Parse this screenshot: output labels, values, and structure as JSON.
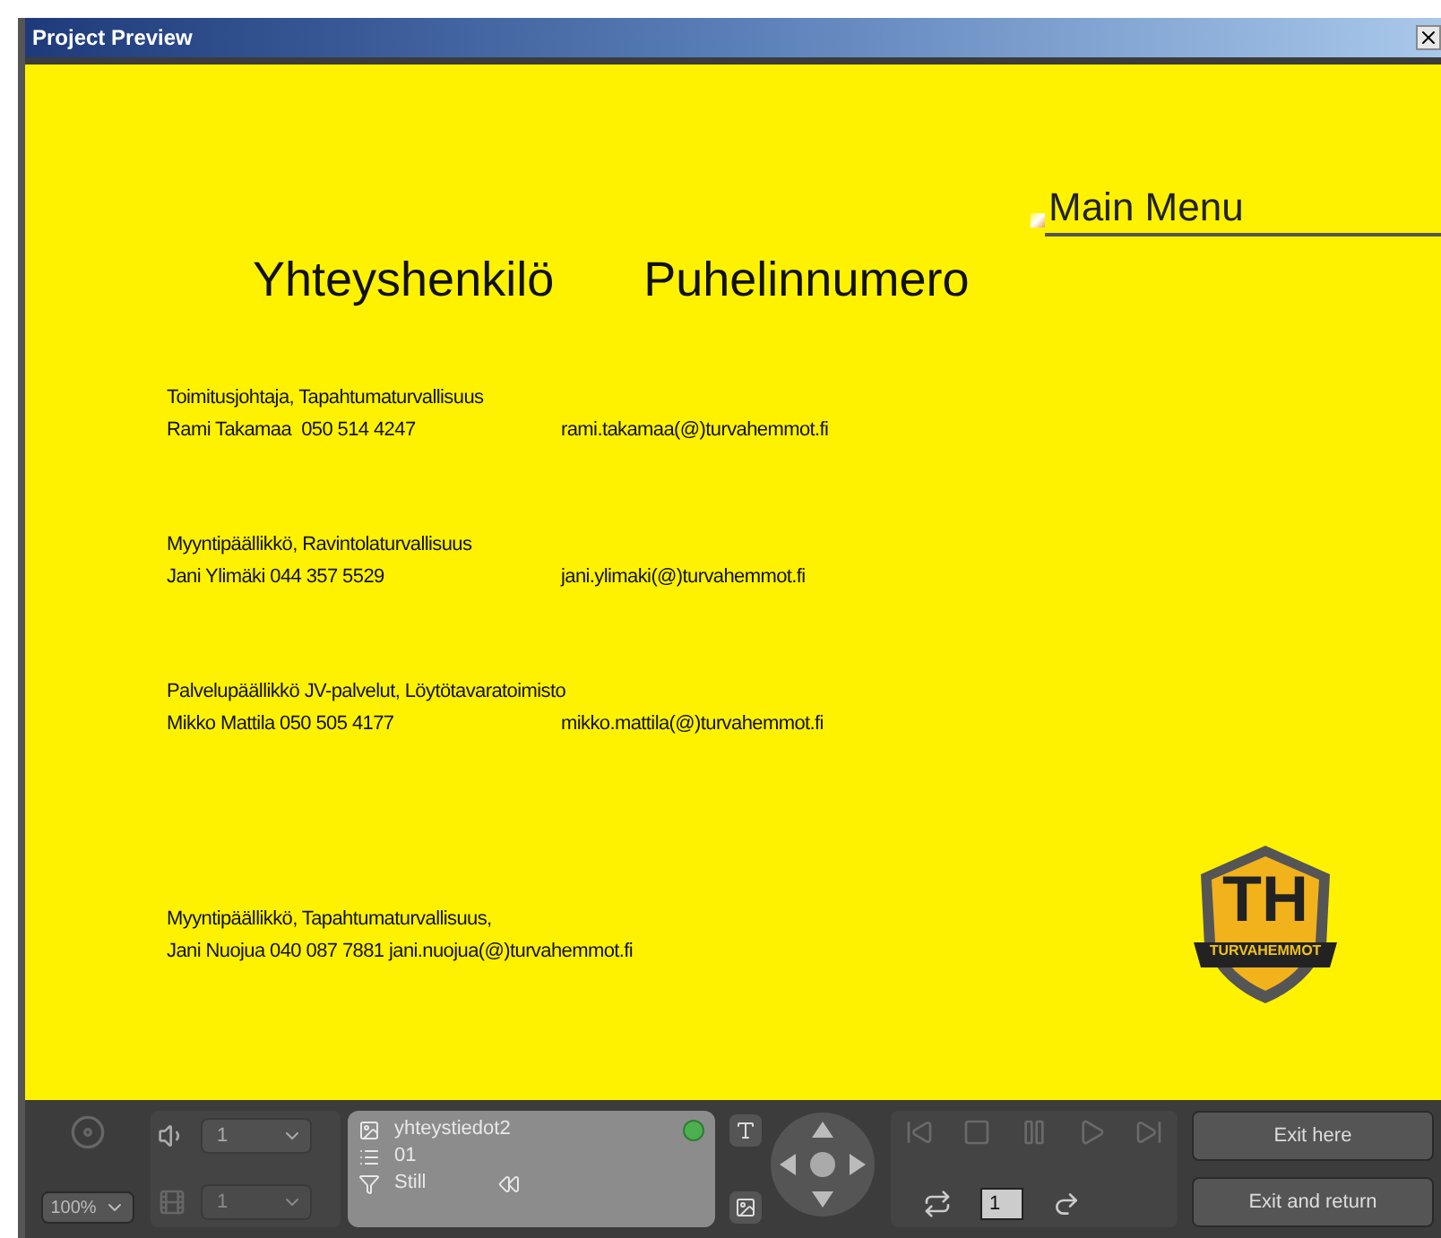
{
  "window": {
    "title": "Project Preview"
  },
  "slide": {
    "main_menu": "Main Menu",
    "headings": [
      "Yhteyshenkilö",
      "Puhelinnumero"
    ],
    "contacts": [
      {
        "title": "Toimitusjohtaja, Tapahtumaturvallisuus",
        "segments": [
          "Rami Takamaa  050 514 4247",
          "rami.takamaa(@)turvahemmot.fi"
        ]
      },
      {
        "title": "Myyntipäällikkö, Ravintolaturvallisuus",
        "segments": [
          "Jani Ylimäki 044 357 5529",
          "jani.ylimaki(@)turvahemmot.fi"
        ]
      },
      {
        "title": "Palvelupäällikkö   JV-palvelut, Löytötavaratoimisto",
        "segments": [
          "Mikko Mattila 050 505 4177",
          "mikko.mattila(@)turvahemmot.fi"
        ]
      },
      {
        "title": "Myyntipäällikkö, Tapahtumaturvallisuus,",
        "segments": [
          "Jani Nuojua 040 087 7881 jani.nuojua(@)turvahemmot.fi"
        ]
      }
    ],
    "logo": {
      "initials": "TH",
      "banner": "TURVAHEMMOT"
    }
  },
  "controls": {
    "zoom": "100%",
    "audio_track": "1",
    "subtitle_track": "1",
    "subtitle_disabled": true,
    "info": {
      "name": "yhteystiedot2",
      "number": "01",
      "type": "Still"
    },
    "counter": "1",
    "transport_disabled": true,
    "buttons": [
      "Exit here",
      "Exit and return"
    ]
  }
}
